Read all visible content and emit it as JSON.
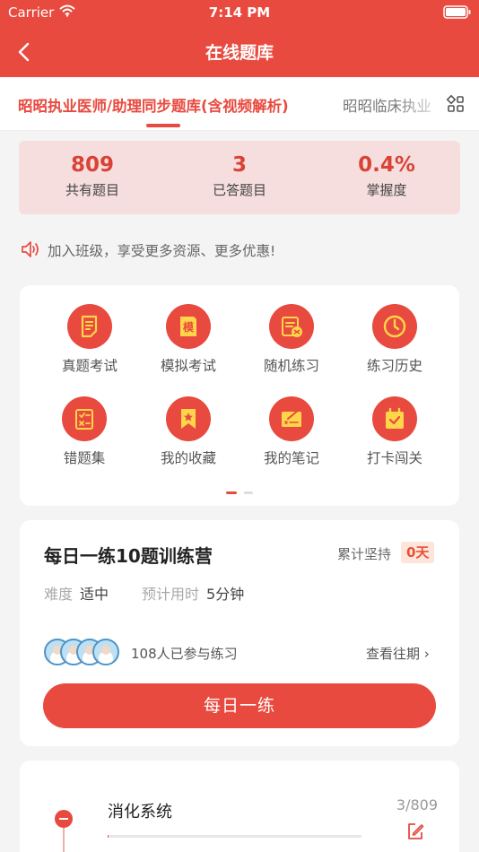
{
  "status_bar": {
    "carrier": "Carrier",
    "time": "7:14 PM"
  },
  "header": {
    "title": "在线题库"
  },
  "tabs": {
    "active": "昭昭执业医师/助理同步题库(含视频解析)",
    "next": "昭昭临床执业"
  },
  "stats": [
    {
      "value": "809",
      "label": "共有题目"
    },
    {
      "value": "3",
      "label": "已答题目"
    },
    {
      "value": "0.4%",
      "label": "掌握度"
    }
  ],
  "notice": {
    "text": "加入班级，享受更多资源、更多优惠!"
  },
  "menu": {
    "items": [
      {
        "label": "真题考试",
        "icon": "paper-icon"
      },
      {
        "label": "模拟考试",
        "icon": "mock-exam-icon",
        "glyph": "模"
      },
      {
        "label": "随机练习",
        "icon": "random-practice-icon"
      },
      {
        "label": "练习历史",
        "icon": "clock-icon"
      },
      {
        "label": "错题集",
        "icon": "checklist-icon"
      },
      {
        "label": "我的收藏",
        "icon": "bookmark-star-icon"
      },
      {
        "label": "我的笔记",
        "icon": "notes-icon"
      },
      {
        "label": "打卡闯关",
        "icon": "calendar-check-icon"
      }
    ],
    "page_count": 2,
    "current_page": 1
  },
  "daily": {
    "title": "每日一练10题训练营",
    "persist_label": "累计坚持",
    "persist_value": "0天",
    "difficulty_label": "难度",
    "difficulty_value": "适中",
    "time_label": "预计用时",
    "time_value": "5分钟",
    "participants": "108人已参与练习",
    "history_link": "查看往期",
    "button": "每日一练"
  },
  "chapter": {
    "name": "消化系统",
    "count": "3/809",
    "progress": 0.0037
  },
  "colors": {
    "accent": "#e84a3f",
    "icon_yellow": "#ffd54a",
    "stats_bg": "#f7dede"
  }
}
